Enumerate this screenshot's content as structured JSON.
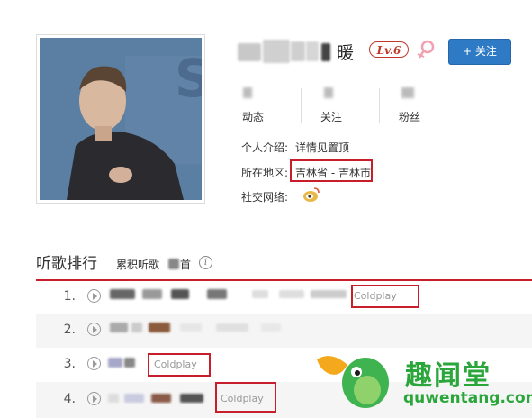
{
  "profile": {
    "name_visible_char": "暖",
    "level": "Lv.6",
    "follow_button_label": "+ 关注"
  },
  "stats": [
    {
      "label": "动态"
    },
    {
      "label": "关注"
    },
    {
      "label": "粉丝"
    }
  ],
  "info": {
    "intro_label": "个人介绍:",
    "intro_value": "详情见置顶",
    "region_label": "所在地区:",
    "region_value": "吉林省 - 吉林市",
    "social_label": "社交网络:"
  },
  "ranking": {
    "title": "听歌排行",
    "subtitle_prefix": "累积听歌",
    "subtitle_suffix": "首",
    "info_icon": "i",
    "rows": [
      {
        "rank": "1.",
        "artist": "Coldplay"
      },
      {
        "rank": "2.",
        "artist": ""
      },
      {
        "rank": "3.",
        "artist": "Coldplay"
      },
      {
        "rank": "4.",
        "artist": "Coldplay"
      }
    ]
  },
  "watermark": {
    "text": "趣闻堂",
    "url": "quwentang.com"
  },
  "colors": {
    "accent_red": "#c81e2b",
    "follow_blue": "#2e7ac5",
    "watermark_green": "#2aa63b"
  },
  "icons": [
    "play-icon",
    "weibo-icon",
    "female-icon",
    "info-icon",
    "parrot-logo"
  ]
}
